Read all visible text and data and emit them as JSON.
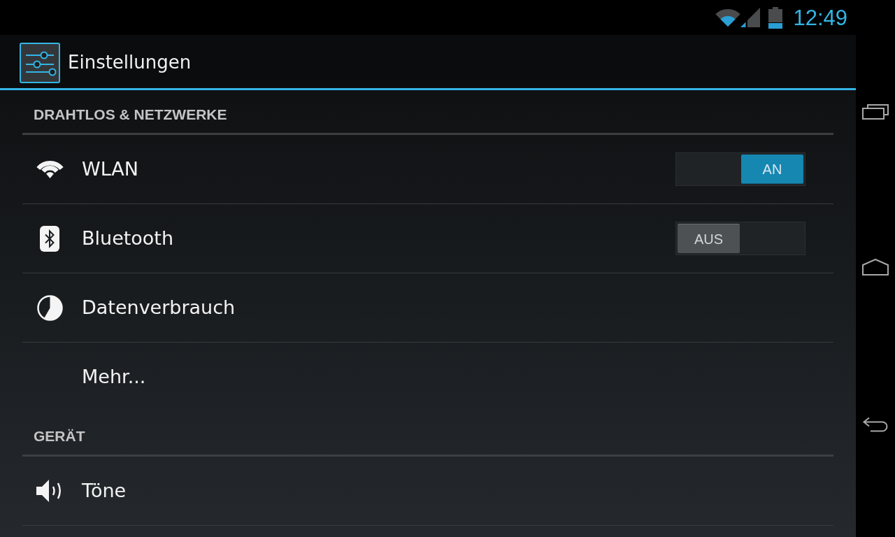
{
  "status_bar": {
    "time": "12:49"
  },
  "action_bar": {
    "title": "Einstellungen"
  },
  "sections": [
    {
      "header": "DRAHTLOS & NETZWERKE",
      "items": [
        {
          "kind": "switch",
          "label": "WLAN",
          "switch": {
            "on": true,
            "text": "AN"
          }
        },
        {
          "kind": "switch",
          "label": "Bluetooth",
          "switch": {
            "on": false,
            "text": "AUS"
          }
        },
        {
          "kind": "plain",
          "label": "Datenverbrauch"
        },
        {
          "kind": "plain",
          "label": "Mehr..."
        }
      ]
    },
    {
      "header": "GERÄT",
      "items": [
        {
          "kind": "plain",
          "label": "Töne"
        }
      ]
    }
  ]
}
